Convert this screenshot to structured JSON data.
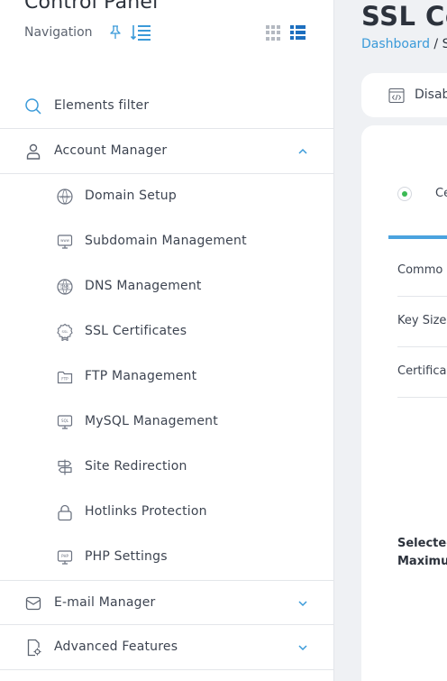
{
  "app": {
    "title": "Control Panel",
    "navigation_label": "Navigation"
  },
  "sidebar": {
    "filter_label": "Elements filter",
    "sections": [
      {
        "label": "Account Manager",
        "icon": "user-icon",
        "expanded": true
      },
      {
        "label": "E-mail Manager",
        "icon": "envelope-icon",
        "expanded": false
      },
      {
        "label": "Advanced Features",
        "icon": "advanced-doc-icon",
        "expanded": false
      }
    ],
    "account_items": [
      {
        "label": "Domain Setup",
        "icon": "www-globe-icon"
      },
      {
        "label": "Subdomain Management",
        "icon": "subdomain-monitor-icon"
      },
      {
        "label": "DNS Management",
        "icon": "dns-globe-icon"
      },
      {
        "label": "SSL Certificates",
        "icon": "ssl-badge-icon"
      },
      {
        "label": "FTP Management",
        "icon": "ftp-folder-icon"
      },
      {
        "label": "MySQL Management",
        "icon": "sql-monitor-icon"
      },
      {
        "label": "Site Redirection",
        "icon": "signpost-icon"
      },
      {
        "label": "Hotlinks Protection",
        "icon": "lock-icon"
      },
      {
        "label": "PHP Settings",
        "icon": "php-monitor-icon"
      }
    ]
  },
  "main": {
    "page_title": "SSL Ce",
    "breadcrumb": {
      "home": "Dashboard",
      "separator": "/",
      "current": "S"
    },
    "toolbar_label": "Disab",
    "radio_label": "Ce",
    "fields": [
      "Commo",
      "Key Size",
      "Certifica"
    ],
    "summary": [
      "Selected",
      "Maximu"
    ]
  },
  "colors": {
    "accent": "#3a9ad9",
    "nav_active": "#1d6fbf",
    "radio_selected": "#3cba54",
    "background": "#eff1f4"
  }
}
